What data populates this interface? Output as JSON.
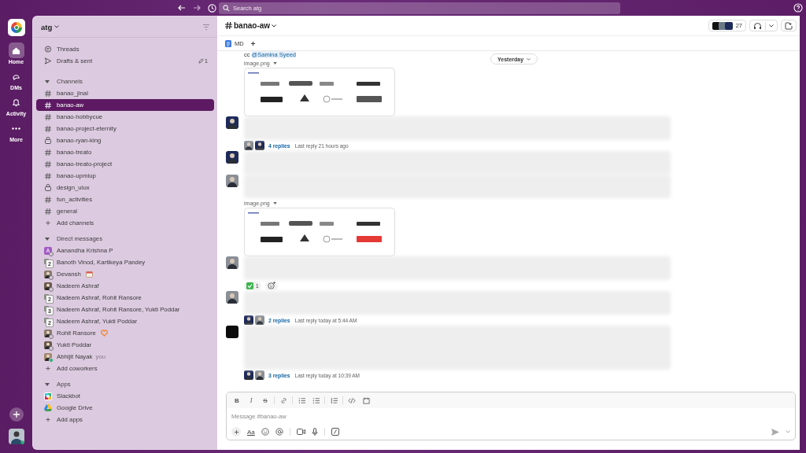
{
  "topbar": {
    "search_placeholder": "Search atg"
  },
  "rail": [
    {
      "label": "Home",
      "selected": true
    },
    {
      "label": "DMs",
      "selected": false
    },
    {
      "label": "Activity",
      "selected": false
    },
    {
      "label": "More",
      "selected": false
    }
  ],
  "workspace": "atg",
  "nav": [
    {
      "label": "Threads"
    },
    {
      "label": "Drafts & sent",
      "badge": "1"
    }
  ],
  "sections": [
    {
      "title": "Channels",
      "expanded": true,
      "add": "Add channels",
      "items": [
        {
          "label": "banao_jinal",
          "kind": "public",
          "selected": false
        },
        {
          "label": "banao-aw",
          "kind": "public",
          "selected": true
        },
        {
          "label": "banao-hobbycue",
          "kind": "public",
          "selected": false
        },
        {
          "label": "banao-project-eternity",
          "kind": "public",
          "selected": false
        },
        {
          "label": "banao-ryan-king",
          "kind": "private",
          "selected": false
        },
        {
          "label": "banao-treato",
          "kind": "public",
          "selected": false
        },
        {
          "label": "banao-treato-project",
          "kind": "public",
          "selected": false
        },
        {
          "label": "banao-upmiup",
          "kind": "public",
          "selected": false
        },
        {
          "label": "design_uiux",
          "kind": "private",
          "selected": false
        },
        {
          "label": "fun_activities",
          "kind": "public",
          "selected": false
        },
        {
          "label": "general",
          "kind": "public",
          "selected": false
        }
      ]
    },
    {
      "title": "Direct messages",
      "expanded": true,
      "add": "Add coworkers",
      "items": [
        {
          "label": "Aanandha Krishna P",
          "kind": "initial",
          "initial": "A",
          "online": false,
          "selected": false
        },
        {
          "label": "Banoth Vinod, Kartikeya Pandey",
          "kind": "group",
          "count": "2",
          "selected": false
        },
        {
          "label": "Devansh",
          "kind": "person",
          "online": false,
          "status": true,
          "selected": false
        },
        {
          "label": "Nadeem Ashraf",
          "kind": "person",
          "online": false,
          "selected": false
        },
        {
          "label": "Nadeem Ashraf, Rohit Ransore",
          "kind": "group",
          "count": "2",
          "selected": false
        },
        {
          "label": "Nadeem Ashraf, Rohit Ransore, Yukti Poddar",
          "kind": "group",
          "count": "3",
          "selected": false
        },
        {
          "label": "Nadeem Ashraf, Yukti Poddar",
          "kind": "group",
          "count": "2",
          "selected": false
        },
        {
          "label": "Rohit Ransore",
          "kind": "person",
          "online": false,
          "status": true,
          "selected": false
        },
        {
          "label": "Yukti Poddar",
          "kind": "person",
          "online": false,
          "selected": false
        },
        {
          "label": "Abhijit Nayak",
          "kind": "person",
          "online": true,
          "suffix": "you",
          "selected": false
        }
      ]
    },
    {
      "title": "Apps",
      "expanded": true,
      "add": "Add apps",
      "items": [
        {
          "label": "Slackbot",
          "kind": "slackbot",
          "selected": false
        },
        {
          "label": "Google Drive",
          "kind": "drive",
          "selected": false
        }
      ]
    }
  ],
  "channel": {
    "name": "banao-aw",
    "member_count": "27",
    "tabs": [
      {
        "label": "MD"
      }
    ]
  },
  "date_divider": "Yesterday",
  "messages": [
    {
      "kind": "attachment",
      "prefix": "cc",
      "mention": "@Samina Syeed",
      "file": "image.png"
    },
    {
      "kind": "post",
      "thread": {
        "replies": "4 replies",
        "last": "Last reply 21 hours ago"
      }
    },
    {
      "kind": "post"
    },
    {
      "kind": "post",
      "file": "image.png"
    },
    {
      "kind": "post",
      "reactions": [
        {
          "kind": "check",
          "count": "1"
        }
      ]
    },
    {
      "kind": "post",
      "thread": {
        "replies": "2 replies",
        "last": "Last reply today at 5:44 AM"
      }
    },
    {
      "kind": "long_post",
      "thread": {
        "replies": "3 replies",
        "last": "Last reply today at 10:39 AM"
      }
    }
  ],
  "composer": {
    "placeholder": "Message #banao-aw",
    "format": [
      {
        "kind": "bold",
        "label": "B"
      },
      {
        "kind": "italic",
        "label": "I"
      },
      {
        "kind": "strike",
        "label": "S"
      },
      {
        "kind": "link"
      },
      {
        "kind": "ol"
      },
      {
        "kind": "ul"
      },
      {
        "kind": "quote"
      },
      {
        "kind": "code"
      },
      {
        "kind": "codeblock"
      }
    ],
    "text_style": "Aa"
  }
}
